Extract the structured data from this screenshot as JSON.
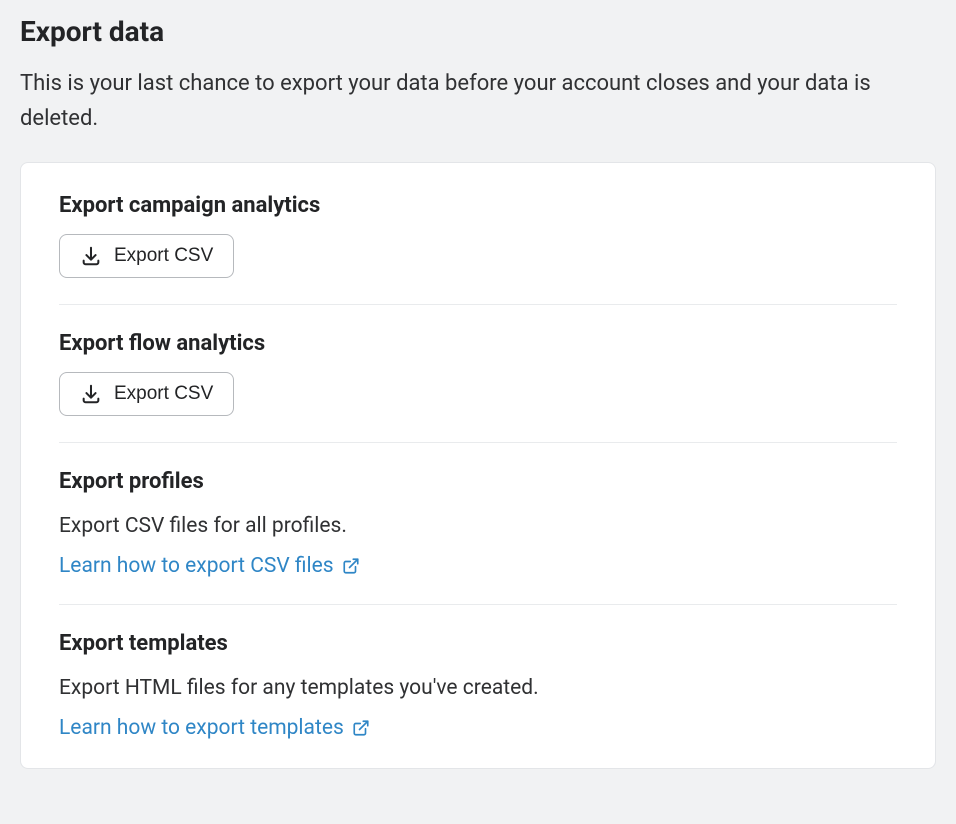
{
  "page": {
    "title": "Export data",
    "subtitle": "This is your last chance to export your data before your account closes and your data is deleted."
  },
  "sections": [
    {
      "title": "Export campaign analytics",
      "button_label": "Export CSV"
    },
    {
      "title": "Export flow analytics",
      "button_label": "Export CSV"
    },
    {
      "title": "Export profiles",
      "description": "Export CSV files for all profiles.",
      "link_label": "Learn how to export CSV files"
    },
    {
      "title": "Export templates",
      "description": "Export HTML files for any templates you've created.",
      "link_label": "Learn how to export templates"
    }
  ]
}
